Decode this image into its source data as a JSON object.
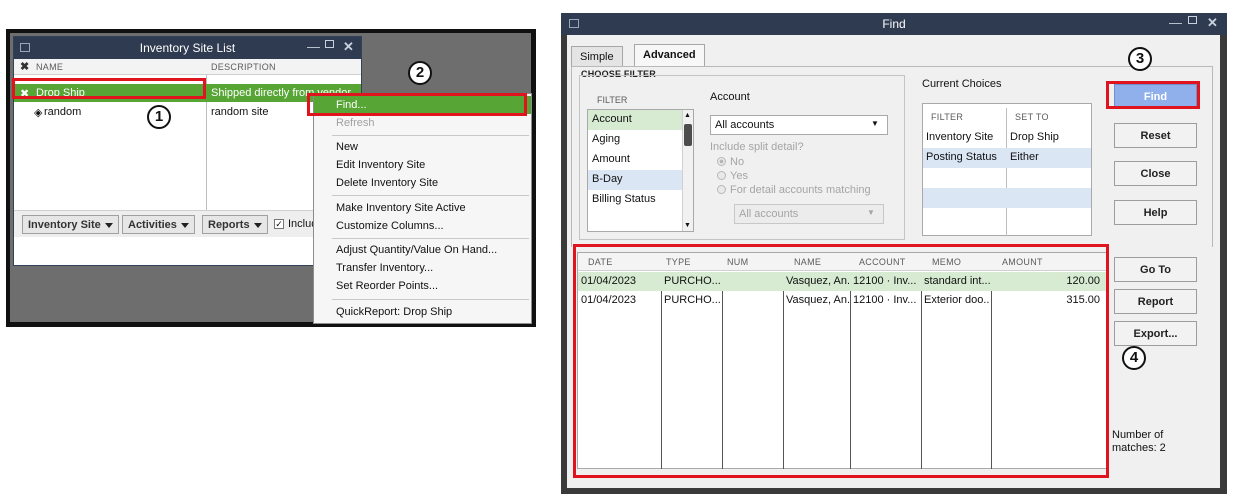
{
  "left": {
    "window_title": "Inventory Site List",
    "columns": [
      "NAME",
      "DESCRIPTION"
    ],
    "rows": [
      {
        "name": "Drop Ship",
        "description": "Shipped directly from vendor"
      },
      {
        "name": "random",
        "description": "random site"
      }
    ],
    "footer": {
      "inventory_site": "Inventory Site",
      "activities": "Activities",
      "reports": "Reports",
      "include_label": "Includ"
    },
    "menu": {
      "find": "Find...",
      "refresh": "Refresh",
      "new": "New",
      "edit": "Edit Inventory Site",
      "delete": "Delete Inventory Site",
      "make_active": "Make Inventory Site Active",
      "customize": "Customize Columns...",
      "adjust": "Adjust Quantity/Value On Hand...",
      "transfer": "Transfer Inventory...",
      "reorder": "Set Reorder Points...",
      "quickreport": "QuickReport: Drop Ship"
    }
  },
  "callouts": [
    "1",
    "2",
    "3",
    "4"
  ],
  "find": {
    "window_title": "Find",
    "tabs": [
      "Simple",
      "Advanced"
    ],
    "choose_filter": "CHOOSE FILTER",
    "filter_col": "FILTER",
    "filters": [
      "Account",
      "Aging",
      "Amount",
      "B-Day",
      "Billing Status"
    ],
    "account_label": "Account",
    "account_value": "All accounts",
    "split_label": "Include split detail?",
    "radio_no": "No",
    "radio_yes": "Yes",
    "radio_detail": "For detail accounts matching",
    "detail_value": "All accounts",
    "current_choices": "Current Choices",
    "cc_columns": [
      "FILTER",
      "SET TO"
    ],
    "cc_rows": [
      {
        "filter": "Inventory Site",
        "set_to": "Drop Ship"
      },
      {
        "filter": "Posting Status",
        "set_to": "Either"
      }
    ],
    "buttons": {
      "find": "Find",
      "reset": "Reset",
      "close": "Close",
      "help": "Help",
      "goto": "Go To",
      "report": "Report",
      "export": "Export..."
    },
    "results_columns": [
      "DATE",
      "TYPE",
      "NUM",
      "NAME",
      "ACCOUNT",
      "MEMO",
      "AMOUNT"
    ],
    "results": [
      {
        "date": "01/04/2023",
        "type": "PURCHO...",
        "num": "",
        "name": "Vasquez, An...",
        "account": "12100 · Inv...",
        "memo": "standard int...",
        "amount": "120.00"
      },
      {
        "date": "01/04/2023",
        "type": "PURCHO...",
        "num": "",
        "name": "Vasquez, An...",
        "account": "12100 · Inv...",
        "memo": "Exterior doo...",
        "amount": "315.00"
      }
    ],
    "matches_label": "Number of matches: 2"
  },
  "colors": {
    "title_bar": "#2f3b51",
    "selection_green": "#57a535",
    "callout_red": "#e0141e",
    "find_button": "#8fb0ea"
  }
}
